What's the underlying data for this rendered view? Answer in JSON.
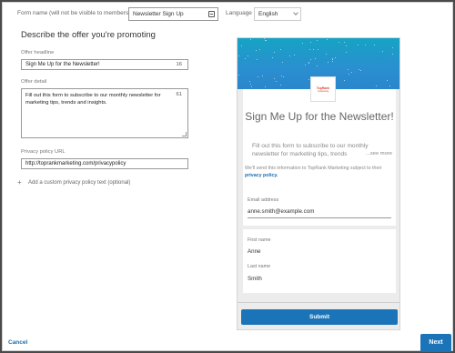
{
  "top": {
    "form_name_label": "Form name (will not be visible to members)",
    "form_name_value": "Newsletter Sign Up",
    "language_label": "Language",
    "language_value": "English"
  },
  "offer": {
    "section_title": "Describe the offer you're promoting",
    "headline_label": "Offer headline",
    "headline_value": "Sign Me Up for the Newsletter!",
    "headline_count": "16",
    "detail_label": "Offer detail",
    "detail_value": "Fill out this form to subscribe to our monthly newsletter for marketing tips, trends and insights.",
    "detail_count": "61",
    "privacy_label": "Privacy policy URL",
    "privacy_value": "http://toprankmarketing.com/privacypolicy",
    "add_privacy_text": "Add a custom privacy policy text (optional)"
  },
  "preview": {
    "logo_line1": "TopRank",
    "logo_line2": "marketing",
    "title": "Sign Me Up for the Newsletter!",
    "description": "Fill out this form to subscribe to our monthly newsletter for marketing tips, trends",
    "see_more": "...see more",
    "consent_prefix": "We'll send this information to TopRank Marketing subject to their",
    "consent_link": "privacy policy.",
    "email_label": "Email address",
    "email_value": "anne.smith@example.com",
    "first_name_label": "First name",
    "first_name_value": "Anne",
    "last_name_label": "Last name",
    "last_name_value": "Smith",
    "submit_label": "Submit"
  },
  "footer": {
    "cancel_label": "Cancel",
    "next_label": "Next"
  },
  "colors": {
    "accent": "#1b74b7",
    "banner_top": "#16a3c4",
    "banner_bottom": "#2b86cc",
    "logo": "#e0412f"
  }
}
